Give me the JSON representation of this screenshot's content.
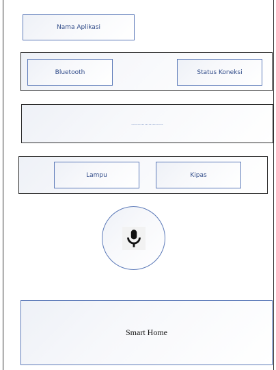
{
  "app_name_label": "Nama Aplikasi",
  "connection_bar": {
    "bluetooth_label": "Bluetooth",
    "status_label": "Status Koneksi"
  },
  "text_display": {
    "value": "........................"
  },
  "controls": {
    "lamp_label": "Lampu",
    "fan_label": "Kipas"
  },
  "mic": {
    "icon": "microphone-icon"
  },
  "footer": {
    "title": "Smart Home"
  }
}
